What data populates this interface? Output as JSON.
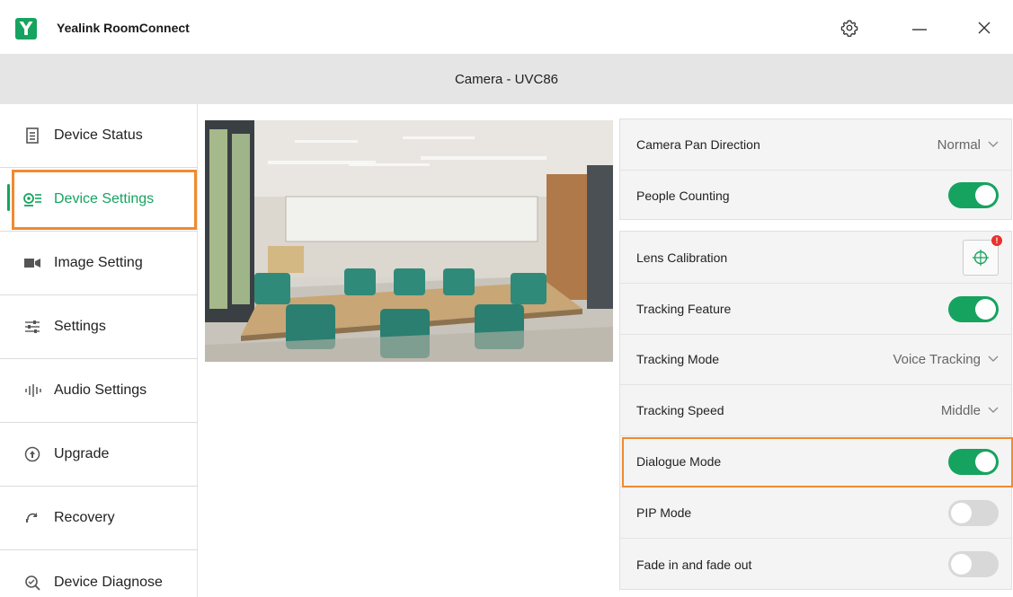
{
  "app": {
    "logo_letter": "Y",
    "title": "Yealink RoomConnect"
  },
  "window_controls": {
    "settings_icon": "gear-icon",
    "minimize_icon": "minimize-icon",
    "close_icon": "close-icon"
  },
  "header": {
    "title": "Camera - UVC86"
  },
  "sidebar": {
    "active_index": 1,
    "items": [
      {
        "label": "Device Status",
        "icon": "document-icon"
      },
      {
        "label": "Device Settings",
        "icon": "device-settings-icon"
      },
      {
        "label": "Image Setting",
        "icon": "video-camera-icon"
      },
      {
        "label": "Settings",
        "icon": "sliders-icon"
      },
      {
        "label": "Audio Settings",
        "icon": "audio-bars-icon"
      },
      {
        "label": "Upgrade",
        "icon": "upgrade-arrow-icon"
      },
      {
        "label": "Recovery",
        "icon": "recovery-icon"
      },
      {
        "label": "Device Diagnose",
        "icon": "diagnose-search-icon"
      }
    ]
  },
  "preview": {
    "description_icon": "camera-preview-image"
  },
  "panel1": {
    "camera_pan_direction": {
      "label": "Camera Pan Direction",
      "value": "Normal"
    },
    "people_counting": {
      "label": "People Counting",
      "on": true
    }
  },
  "panel2": {
    "lens_calibration": {
      "label": "Lens Calibration",
      "badge": "!"
    },
    "tracking_feature": {
      "label": "Tracking Feature",
      "on": true
    },
    "tracking_mode": {
      "label": "Tracking Mode",
      "value": "Voice Tracking"
    },
    "tracking_speed": {
      "label": "Tracking Speed",
      "value": "Middle"
    },
    "dialogue_mode": {
      "label": "Dialogue Mode",
      "on": true
    },
    "pip_mode": {
      "label": "PIP Mode",
      "on": false
    },
    "fade": {
      "label": "Fade in and fade out",
      "on": false
    }
  },
  "colors": {
    "accent": "#16a35f",
    "highlight": "#f08a30",
    "header_bg": "#e5e5e5",
    "panel_bg": "#f4f4f4"
  }
}
